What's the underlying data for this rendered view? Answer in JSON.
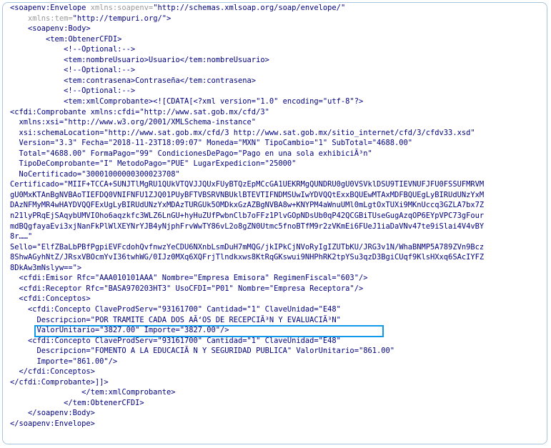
{
  "lines": [
    {
      "parts": [
        {
          "t": "<soapenv:Envelope ",
          "c": "plain"
        },
        {
          "t": "xmlns:soapenv=",
          "c": "attr"
        },
        {
          "t": "\"http://schemas.xmlsoap.org/soap/envelope/\"",
          "c": "str"
        }
      ]
    },
    {
      "parts": [
        {
          "t": "    ",
          "c": "plain"
        },
        {
          "t": "xmlns:tem=",
          "c": "attr"
        },
        {
          "t": "\"http://tempuri.org/\">",
          "c": "str"
        }
      ]
    },
    {
      "parts": [
        {
          "t": "    <soapenv:Body>",
          "c": "plain"
        }
      ]
    },
    {
      "parts": [
        {
          "t": "        <tem:ObtenerCFDI>",
          "c": "plain"
        }
      ]
    },
    {
      "parts": [
        {
          "t": "            <!--Optional:-->",
          "c": "plain"
        }
      ]
    },
    {
      "parts": [
        {
          "t": "            <tem:nombreUsuario>Usuario</tem:nombreUsuario>",
          "c": "plain"
        }
      ]
    },
    {
      "parts": [
        {
          "t": "            <!--Optional:-->",
          "c": "plain"
        }
      ]
    },
    {
      "parts": [
        {
          "t": "            <tem:contrasena>Contraseña</tem:contrasena>",
          "c": "plain"
        }
      ]
    },
    {
      "parts": [
        {
          "t": "            <!--Optional:-->",
          "c": "plain"
        }
      ]
    },
    {
      "parts": [
        {
          "t": "            <tem:xmlComprobante><![CDATA[<?xml version=\"1.0\" encoding=\"utf-8\"?>",
          "c": "plain"
        }
      ]
    },
    {
      "parts": [
        {
          "t": "<cfdi:Comprobante xmlns:cfdi=\"http://www.sat.gob.mx/cfd/3\"",
          "c": "plain"
        }
      ]
    },
    {
      "parts": [
        {
          "t": "  xmlns:xsi=\"http://www.w3.org/2001/XMLSchema-instance\"",
          "c": "plain"
        }
      ]
    },
    {
      "parts": [
        {
          "t": "  xsi:schemaLocation=\"http://www.sat.gob.mx/cfd/3 http://www.sat.gob.mx/sitio_internet/cfd/3/cfdv33.xsd\"",
          "c": "plain"
        }
      ]
    },
    {
      "parts": [
        {
          "t": "  Version=\"3.3\" Fecha=\"2018-11-23T18:09:07\" Moneda=\"MXN\" TipoCambio=\"1\" SubTotal=\"4688.00\"",
          "c": "plain"
        }
      ]
    },
    {
      "parts": [
        {
          "t": "  Total=\"4688.00\" FormaPago=\"99\" CondicionesDePago=\"Pago en una sola exhibiciÃ³n\"",
          "c": "plain"
        }
      ]
    },
    {
      "parts": [
        {
          "t": "  TipoDeComprobante=\"I\" MetodoPago=\"PUE\" LugarExpedicion=\"25000\"",
          "c": "plain"
        }
      ]
    },
    {
      "parts": [
        {
          "t": "  NoCertificado=\"30001000000300023708\"",
          "c": "plain"
        }
      ]
    },
    {
      "parts": [
        {
          "t": "Certificado=\"MIIF+TCCA+SUNJTlMgRU1QUkVTQVJJQUxFUyBTQzEpMCcGA1UEKRMgQUNDRU0gU0VSVklDSU9TIEVNUFJFU0FSSUFMRVM",
          "c": "plain"
        }
      ]
    },
    {
      "parts": [
        {
          "t": "gU0MxKTAnBgNVBAoTIEFDQ0VNIFNFU1ZJQ01PUyBFTVBSRVNBUklBTEVTIFNDMSUwIwYDVQQtExxBQUEwMTAxMDFBQUEgLyBIRUdUNzYxM",
          "c": "plain"
        }
      ]
    },
    {
      "parts": [
        {
          "t": "DAzNFMyMR4wHAYDVQQFExUgLyBIRUdUNzYxMDAzTURGUk5OMDkxGzAZBgNVBA8w+KNYPM4aWnuUMl0mLgtOxTUXi9MKnUccq3GZLA7bx7Z",
          "c": "plain"
        }
      ]
    },
    {
      "parts": [
        {
          "t": "n21lyPRqEjSAqybUMVIOho6aqzkfc3WLZ6LnGU+hyHuZUfPwbnClb7oFFz1PlvGOpNDsUb0qP42QCGBiTUseGugAzqOP6EYpVPC73gFour",
          "c": "plain"
        }
      ]
    },
    {
      "parts": [
        {
          "t": "mdBQgfayaEvi3xjNanFkPlWlXEYNrYJB4yNjphFrvWwTY86vL2o8gZN0Utmc5fnoBTfM9r2zVKmEi6FUeJ1iaDaVNv47te9iSlai4V4vBY",
          "c": "plain"
        }
      ]
    },
    {
      "parts": [
        {
          "t": "8r……\"",
          "c": "plain"
        }
      ]
    },
    {
      "parts": [
        {
          "t": "Sello=\"ElfZBaLbPBfPgpiEVFcdohQvfnwzYeCDU6NXnbLsmDuH7mMQG/jkIPkCjNVoRyIgIZUTbKU/JRG3v1N/WhaBNMP5A789ZVn9Bcz",
          "c": "plain"
        }
      ]
    },
    {
      "parts": [
        {
          "t": "8ShwAGyhNtZ/JRsxVBOcmYvI36twhWG/0IJz0MXq6XQFrjTlndkxws8KtRqGKswui9NHPhRK2tpYSu3qzD3BgiCUqf9KlsHXxq6SAcIYFZ",
          "c": "plain"
        }
      ]
    },
    {
      "parts": [
        {
          "t": "8DkAw3mNslyw==\">",
          "c": "plain"
        }
      ]
    },
    {
      "parts": [
        {
          "t": "  <cfdi:Emisor Rfc=\"AAA010101AAA\" Nombre=\"Empresa Emisora\" RegimenFiscal=\"603\"/>",
          "c": "plain"
        }
      ]
    },
    {
      "parts": [
        {
          "t": "  <cfdi:Receptor Rfc=\"BASA970203HT3\" UsoCFDI=\"P01\" Nombre=\"Empresa Receptora\"/>",
          "c": "plain"
        }
      ]
    },
    {
      "parts": [
        {
          "t": "  <cfdi:Conceptos>",
          "c": "plain"
        }
      ]
    },
    {
      "parts": [
        {
          "t": "    <cfdi:Concepto ClaveProdServ=\"93161700\" Cantidad=\"1\" ClaveUnidad=\"E48\"",
          "c": "plain"
        }
      ]
    },
    {
      "parts": [
        {
          "t": "      Descripcion=\"POR TRAMITE CADA DOS AÃ‘OS DE RECEPCIÃ³N Y EVALUACIÃ³N\"",
          "c": "plain"
        }
      ]
    },
    {
      "parts": [
        {
          "t": "      ValorUnitario=\"3827.00\" Importe=\"3827.00\"/>",
          "c": "plain"
        }
      ]
    },
    {
      "parts": [
        {
          "t": "    <cfdi:Concepto ClaveProdServ=\"93161700\" Cantidad=\"1\" ClaveUnidad=\"E48\"",
          "c": "plain"
        }
      ]
    },
    {
      "parts": [
        {
          "t": "      Descripcion=\"FOMENTO A LA EDUCACIÃ N Y SEGURIDAD PUBLICA\" ValorUnitario=\"861.00\"",
          "c": "plain"
        }
      ]
    },
    {
      "parts": [
        {
          "t": "      Importe=\"861.00\"/>",
          "c": "plain"
        }
      ]
    },
    {
      "parts": [
        {
          "t": "  </cfdi:Conceptos>",
          "c": "plain"
        }
      ]
    },
    {
      "parts": [
        {
          "t": "</cfdi:Comprobante>]]>",
          "c": "plain"
        }
      ]
    },
    {
      "parts": [
        {
          "t": "                </tem:xmlComprobante>",
          "c": "plain"
        }
      ]
    },
    {
      "parts": [
        {
          "t": "            </tem:ObtenerCFDI>",
          "c": "plain"
        }
      ]
    },
    {
      "parts": [
        {
          "t": "    </soapenv:Body>",
          "c": "plain"
        }
      ]
    },
    {
      "parts": [
        {
          "t": "</soapenv:Envelope>",
          "c": "plain"
        }
      ]
    }
  ],
  "colors": {
    "text": "#000080",
    "attr": "#9a9a9a",
    "highlight": "#0e9ae8",
    "frame": "#a9c4dd"
  }
}
